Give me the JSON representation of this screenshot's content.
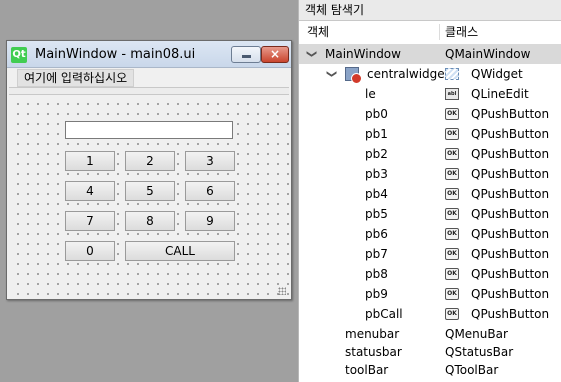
{
  "designer": {
    "window_title": "MainWindow - main08.ui",
    "logo_text": "Qt",
    "close_glyph": "×",
    "menu_placeholder": "여기에 입력하십시오",
    "buttons": {
      "pb1": "1",
      "pb2": "2",
      "pb3": "3",
      "pb4": "4",
      "pb5": "5",
      "pb6": "6",
      "pb7": "7",
      "pb8": "8",
      "pb9": "9",
      "pb0": "0",
      "pbCall": "CALL"
    },
    "line_edit_value": ""
  },
  "inspector": {
    "title": "객체 탐색기",
    "col_object": "객체",
    "col_class": "클래스",
    "rows": [
      {
        "name": "MainWindow",
        "class": "QMainWindow",
        "icon": "",
        "selected": true
      },
      {
        "name": "centralwidget",
        "class": "QWidget",
        "icon": "widget-icon"
      },
      {
        "name": "le",
        "class": "QLineEdit",
        "icon": "lineedit-icon"
      },
      {
        "name": "pb0",
        "class": "QPushButton",
        "icon": "pushbutton-icon"
      },
      {
        "name": "pb1",
        "class": "QPushButton",
        "icon": "pushbutton-icon"
      },
      {
        "name": "pb2",
        "class": "QPushButton",
        "icon": "pushbutton-icon"
      },
      {
        "name": "pb3",
        "class": "QPushButton",
        "icon": "pushbutton-icon"
      },
      {
        "name": "pb4",
        "class": "QPushButton",
        "icon": "pushbutton-icon"
      },
      {
        "name": "pb5",
        "class": "QPushButton",
        "icon": "pushbutton-icon"
      },
      {
        "name": "pb6",
        "class": "QPushButton",
        "icon": "pushbutton-icon"
      },
      {
        "name": "pb7",
        "class": "QPushButton",
        "icon": "pushbutton-icon"
      },
      {
        "name": "pb8",
        "class": "QPushButton",
        "icon": "pushbutton-icon"
      },
      {
        "name": "pb9",
        "class": "QPushButton",
        "icon": "pushbutton-icon"
      },
      {
        "name": "pbCall",
        "class": "QPushButton",
        "icon": "pushbutton-icon"
      },
      {
        "name": "menubar",
        "class": "QMenuBar",
        "icon": ""
      },
      {
        "name": "statusbar",
        "class": "QStatusBar",
        "icon": ""
      },
      {
        "name": "toolBar",
        "class": "QToolBar",
        "icon": ""
      }
    ],
    "icon_texts": {
      "pushbutton": "OK",
      "lineedit": "abl"
    },
    "arrow_expanded": "❯"
  },
  "colors": {
    "desktop": "#a0a0a0",
    "selection": "#d9d9d9",
    "qt_green": "#41cd52"
  }
}
